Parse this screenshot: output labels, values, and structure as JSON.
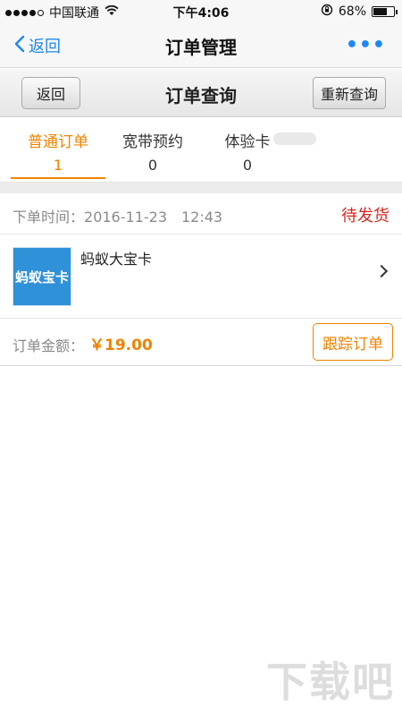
{
  "status_bar": {
    "carrier": "中国联通",
    "time": "下午4:06",
    "battery": "68%",
    "battery_level": 0.68,
    "signal_bars": 4
  },
  "navbar": {
    "back_label": "返回",
    "title": "订单管理",
    "more_label": "•••"
  },
  "subheader": {
    "back_label": "返回",
    "title": "订单查询",
    "requery_label": "重新查询"
  },
  "tabs": [
    {
      "label": "普通订单",
      "count": "1",
      "active": true
    },
    {
      "label": "宽带预约",
      "count": "0",
      "active": false
    },
    {
      "label": "体验卡",
      "count": "0",
      "active": false
    }
  ],
  "order": {
    "time_label": "下单时间：",
    "time_value": "2016-11-23　12:43",
    "status": "待发货",
    "product_thumb_text": "蚂蚁宝卡",
    "product_name": "蚂蚁大宝卡",
    "amount_label": "订单金额：",
    "amount_value": "￥19.00",
    "track_label": "跟踪订单"
  },
  "colors": {
    "accent_blue": "#1e88f0",
    "accent_orange": "#f08300",
    "status_red": "#d8251e"
  },
  "watermark": "下载吧"
}
